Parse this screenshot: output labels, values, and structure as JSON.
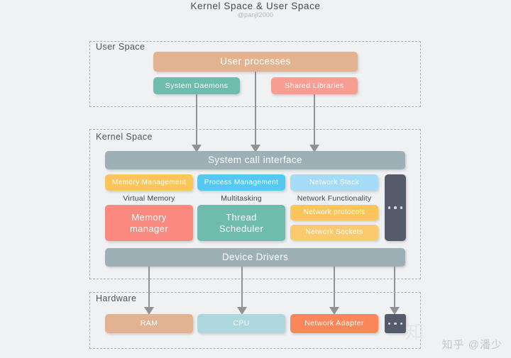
{
  "header": {
    "title": "Kernel Space & User Space",
    "subtitle": "@panjf2000"
  },
  "regions": {
    "user_space": {
      "label": "User Space"
    },
    "kernel_space": {
      "label": "Kernel Space"
    },
    "hardware": {
      "label": "Hardware"
    }
  },
  "user_space": {
    "user_processes": {
      "label": "User processes",
      "color": "#e3b391"
    },
    "system_daemons": {
      "label": "System Daemons",
      "color": "#6dbcae"
    },
    "shared_libraries": {
      "label": "Shared Libraries",
      "color": "#f79d92"
    }
  },
  "kernel_space": {
    "system_call_interface": {
      "label": "System call interface",
      "color": "#9cb0b6"
    },
    "device_drivers": {
      "label": "Device Drivers",
      "color": "#9cb0b6"
    },
    "memory_management": {
      "label": "Memory Management",
      "color": "#fcc55b"
    },
    "memory_caption": "Virtual Memory",
    "memory_manager": {
      "label": "Memory\nmanager",
      "color": "#fa8a80"
    },
    "process_management": {
      "label": "Process Management",
      "color": "#55c8f2"
    },
    "process_caption": "Multitasking",
    "thread_scheduler": {
      "label": "Thread\nScheduler",
      "color": "#6dbcae"
    },
    "network_stack": {
      "label": "Network Stack",
      "color": "#a6dbf5"
    },
    "network_caption": "Network Functionality",
    "network_protocols": {
      "label": "Network protocols",
      "color": "#fcc55b"
    },
    "network_sockets": {
      "label": "Network Sockets",
      "color": "#fcca6e"
    },
    "more": {
      "label": "...",
      "color": "#545b6b"
    }
  },
  "hardware": {
    "ram": {
      "label": "RAM",
      "color": "#e3b391"
    },
    "cpu": {
      "label": "CPU",
      "color": "#aed8de"
    },
    "network_adapter": {
      "label": "Network Adapter",
      "color": "#fb8659"
    },
    "more": {
      "label": "...",
      "color": "#545b6b"
    }
  },
  "watermark": {
    "text": "知乎 @潘少",
    "glyph": "知"
  },
  "colors": {
    "background": "#f0f1f2",
    "arrow": "#8f9296",
    "dashed_border": "#a9adb1",
    "title_text": "#4a4a4a"
  }
}
